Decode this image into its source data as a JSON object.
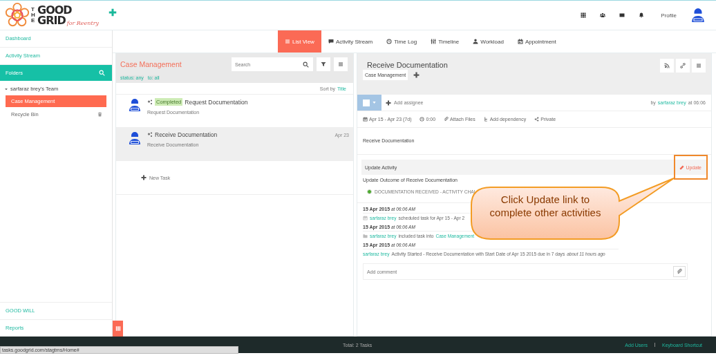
{
  "header": {
    "logo_words": [
      "THE",
      "GOOD",
      "GRID",
      "for Reentry"
    ],
    "profile_label": "Profile"
  },
  "sidebar": {
    "top_items": [
      "Dashboard",
      "Activity Stream"
    ],
    "folders_label": "Folders",
    "team": {
      "name": "sarfaraz brey's Team",
      "expanded": true,
      "children": [
        {
          "label": "Case Management",
          "kind": "folder",
          "selected": true
        },
        {
          "label": "Recycle Bin",
          "kind": "trash",
          "selected": false
        }
      ]
    },
    "bottom_items": [
      "GOOD WILL",
      "Reports"
    ]
  },
  "tabs": [
    {
      "label": "List View",
      "selected": true
    },
    {
      "label": "Activity Stream",
      "selected": false
    },
    {
      "label": "Time Log",
      "selected": false
    },
    {
      "label": "Timeline",
      "selected": false
    },
    {
      "label": "Workload",
      "selected": false
    },
    {
      "label": "Appointment",
      "selected": false
    }
  ],
  "list_panel": {
    "title": "Case Management",
    "search": {
      "placeholder": "Search"
    },
    "filters": [
      "status: any",
      "to: all"
    ],
    "sort_label": "Sort by",
    "sort_field": "Title",
    "tasks": [
      {
        "status": "Completed",
        "title": "Request Documentation",
        "subtitle": "Request Documentation",
        "selected": false
      },
      {
        "title": "Receive Documentation",
        "subtitle": "Receive Documentation",
        "date": "Apr 23",
        "selected": true
      }
    ],
    "new_task": "New Task"
  },
  "detail": {
    "title": "Receive Documentation",
    "tag": "Case Management",
    "checked": false,
    "add_assignee": "Add assignee",
    "by_prefix": "by",
    "by_user": "sarfaraz brey",
    "by_suffix": "at 06:06",
    "meta": [
      "Apr 15 - Apr 23 (7d)",
      "0:00",
      "Attach Files",
      "Add dependency",
      "Private"
    ],
    "description": "Receive Documentation",
    "update_activity": {
      "label": "Update Activity",
      "link": "Update",
      "outcome_title": "Update Outcome of Receive Documentation",
      "options": [
        {
          "label": "DOCUMENTATION RECEIVED - ACTIVITY CHAI",
          "selected": true
        }
      ]
    },
    "log": [
      {
        "date": "15 Apr 2015",
        "time": "at 06:06 AM",
        "user": "sarfaraz brey",
        "text": "scheduled task for Apr 15 - Apr 2"
      },
      {
        "date": "15 Apr 2015",
        "time": "at 06:06 AM",
        "user": "sarfaraz brey",
        "text": "included task into",
        "link": "Case Management"
      },
      {
        "date": "15 Apr 2015",
        "time": "at 06:06 AM",
        "user": "sarfaraz brey",
        "text": "Activity Started - Receive Documentation with Start Date of Apr 15 2015 due in 7 days",
        "ago": "about 11 hours ago"
      }
    ],
    "comment": {
      "placeholder": "Add comment"
    }
  },
  "callout": "Click Update link to complete other activities",
  "footer": {
    "total": "Total: 2 Tasks",
    "links": [
      "Add Users",
      "Keyboard Shortcut"
    ]
  },
  "status_url": "tasks.goodgrid.com/stagtms/Home#"
}
